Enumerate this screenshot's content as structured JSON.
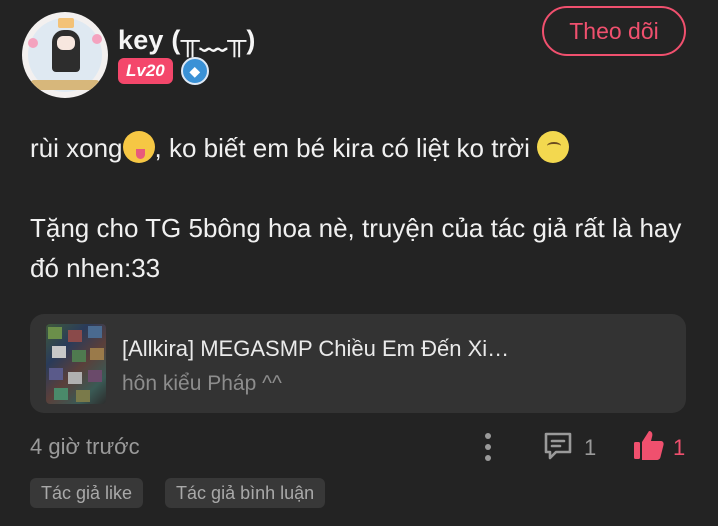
{
  "author": {
    "name": "key (╥﹏╥)",
    "level": "Lv20",
    "badge_icon": "diamond-icon"
  },
  "follow_label": "Theo dõi",
  "comment": {
    "line1_a": "rùi xong",
    "line1_b": ", ko biết em bé kira có liệt ko trời",
    "line2": "Tặng cho TG 5bông hoa nè, truyện của tác giả rất là hay đó nhen:33"
  },
  "story_card": {
    "title": "[Allkira] MEGASMP Chiều Em Đến Xi…",
    "subtitle": "hôn kiểu Pháp ^^"
  },
  "meta": {
    "time": "4 giờ trước",
    "comment_count": "1",
    "like_count": "1"
  },
  "tags": [
    "Tác giả like",
    "Tác giả bình luận"
  ],
  "colors": {
    "accent": "#f0506e",
    "background": "#232323",
    "card": "#333333"
  }
}
